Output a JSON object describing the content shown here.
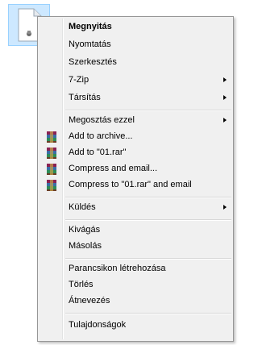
{
  "file": {
    "icon": "text-document-icon"
  },
  "menu": {
    "items": [
      {
        "label": "Megnyitás",
        "bold": true
      },
      {
        "label": "Nyomtatás"
      },
      {
        "label": "Szerkesztés"
      },
      {
        "label": "7-Zip",
        "submenu": true
      },
      {
        "label": "Társítás",
        "submenu": true
      },
      {
        "label": "Megosztás ezzel",
        "submenu": true
      },
      {
        "label": "Add to archive...",
        "icon": "winrar-icon"
      },
      {
        "label": "Add to \"01.rar\"",
        "icon": "winrar-icon"
      },
      {
        "label": "Compress and email...",
        "icon": "winrar-icon"
      },
      {
        "label": "Compress to \"01.rar\" and email",
        "icon": "winrar-icon"
      },
      {
        "label": "Küldés",
        "submenu": true
      },
      {
        "label": "Kivágás"
      },
      {
        "label": "Másolás"
      },
      {
        "label": "Parancsikon létrehozása"
      },
      {
        "label": "Törlés"
      },
      {
        "label": "Átnevezés"
      },
      {
        "label": "Tulajdonságok"
      }
    ]
  },
  "colors": {
    "menu_bg": "#f0f0f0",
    "selection_bg": "#cde8ff",
    "border": "#979797"
  }
}
